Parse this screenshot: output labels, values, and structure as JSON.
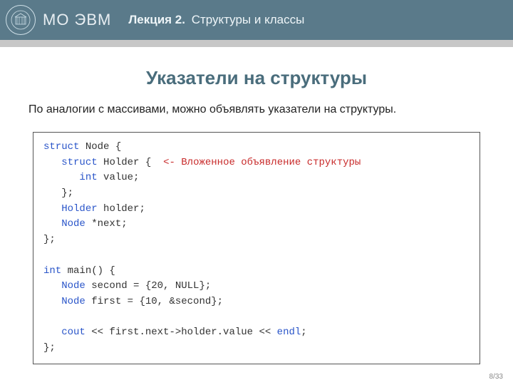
{
  "header": {
    "brand": "МО ЭВМ",
    "lecture_prefix": "Лекция 2.",
    "lecture_title": "Структуры и классы"
  },
  "slide": {
    "title": "Указатели на структуры",
    "body": "По аналогии с массивами, можно объявлять указатели на структуры."
  },
  "code": {
    "l1_kw": "struct",
    "l1_rest": " Node {",
    "l2_kw": "struct",
    "l2_rest": " Holder {  ",
    "l2_comment": "<- Вложенное объявление структуры",
    "l3_kw": "int",
    "l3_rest": " value;",
    "l4": "   };",
    "l5_kw": "Holder",
    "l5_rest": " holder;",
    "l6_kw": "Node",
    "l6_rest": " *next;",
    "l7": "};",
    "l9_kw": "int",
    "l9_rest": " main() {",
    "l10_kw": "Node",
    "l10_rest": " second = {20, NULL};",
    "l11_kw": "Node",
    "l11_rest": " first = {10, &second};",
    "l13_kw": "cout",
    "l13_mid": " << first.next->holder.value << ",
    "l13_kw2": "endl",
    "l13_end": ";",
    "l14": "};"
  },
  "pager": "8/33"
}
